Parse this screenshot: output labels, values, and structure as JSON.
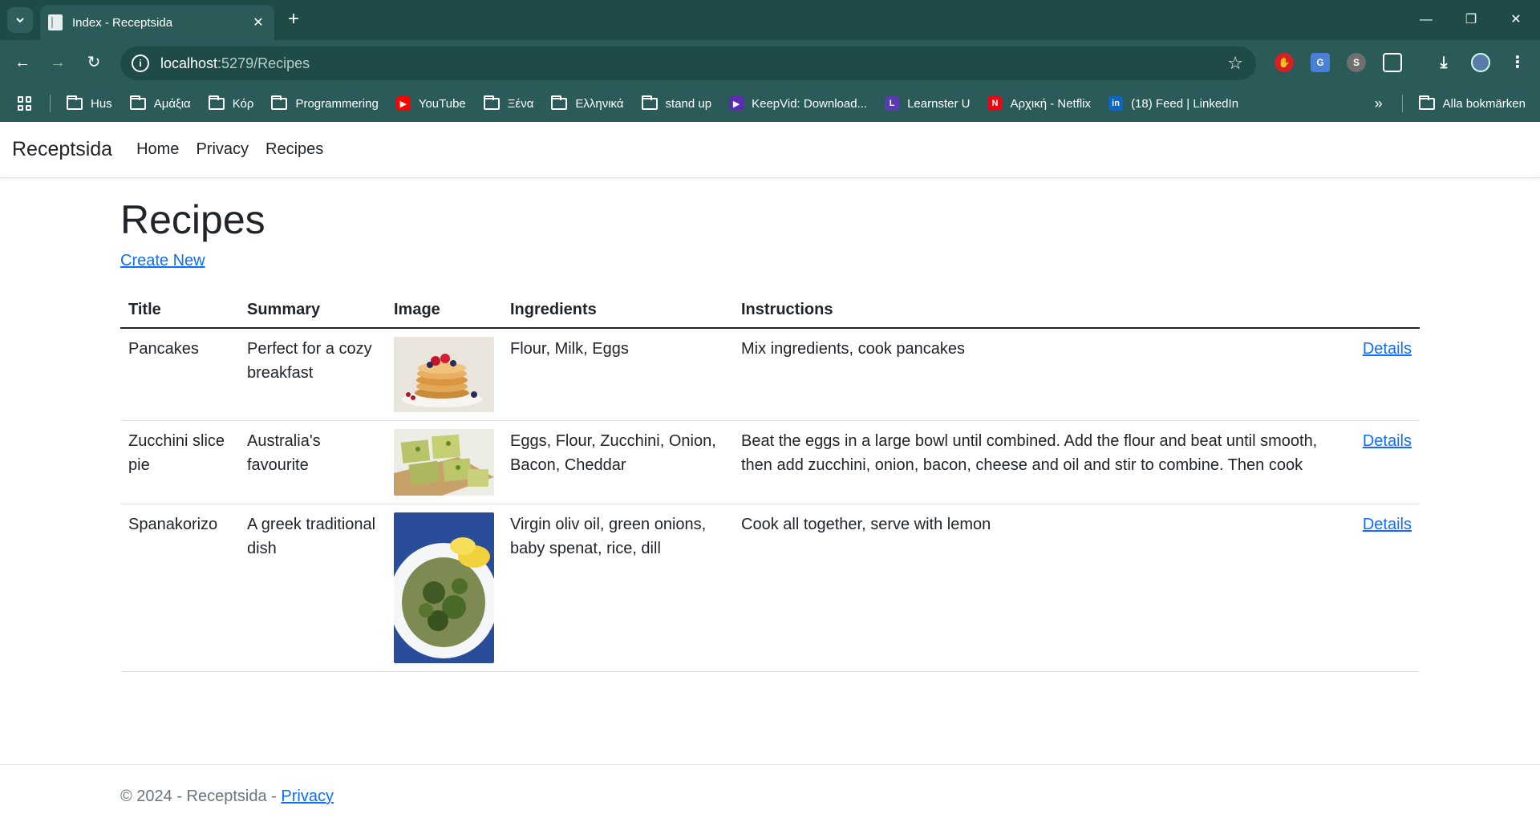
{
  "browser": {
    "tab_title": "Index - Receptsida",
    "url_host": "localhost",
    "url_path": ":5279/Recipes",
    "bookmarks": [
      {
        "label": "Hus",
        "icon": "folder-icon"
      },
      {
        "label": "Αμάξια",
        "icon": "folder-icon"
      },
      {
        "label": "Κόρ",
        "icon": "folder-icon"
      },
      {
        "label": "Programmering",
        "icon": "folder-icon"
      },
      {
        "label": "YouTube",
        "icon": "youtube-icon",
        "color": "#ff0000"
      },
      {
        "label": "Ξένα",
        "icon": "folder-icon"
      },
      {
        "label": "Ελληνικά",
        "icon": "folder-icon"
      },
      {
        "label": "stand up",
        "icon": "folder-icon"
      },
      {
        "label": "KeepVid: Download...",
        "icon": "keepvid-icon",
        "color": "#5b2bb5"
      },
      {
        "label": "Learnster U",
        "icon": "learnster-icon",
        "color": "#5a3ab0"
      },
      {
        "label": "Αρχική - Netflix",
        "icon": "netflix-icon",
        "color": "#e50914"
      },
      {
        "label": "(18) Feed | LinkedIn",
        "icon": "linkedin-icon",
        "color": "#0a66c2"
      }
    ],
    "all_bookmarks": "Alla bokmärken"
  },
  "site": {
    "brand": "Receptsida",
    "nav": [
      "Home",
      "Privacy",
      "Recipes"
    ]
  },
  "page": {
    "title": "Recipes",
    "create_new": "Create New",
    "columns": [
      "Title",
      "Summary",
      "Image",
      "Ingredients",
      "Instructions"
    ],
    "details_label": "Details",
    "rows": [
      {
        "title": "Pancakes",
        "summary": "Perfect for a cozy breakfast",
        "image": "pancakes-image",
        "ingredients": "Flour, Milk, Eggs",
        "instructions": "Mix ingredients, cook pancakes"
      },
      {
        "title": "Zucchini slice pie",
        "summary": "Australia's favourite",
        "image": "zucchini-slice-image",
        "ingredients": "Eggs, Flour, Zucchini, Onion, Bacon, Cheddar",
        "instructions": "Beat the eggs in a large bowl until combined. Add the flour and beat until smooth, then add zucchini, onion, bacon, cheese and oil and stir to combine. Then cook"
      },
      {
        "title": "Spanakorizo",
        "summary": "A greek traditional dish",
        "image": "spanakorizo-image",
        "ingredients": "Virgin oliv oil, green onions, baby spenat, rice, dill",
        "instructions": "Cook all together, serve with lemon"
      }
    ]
  },
  "footer": {
    "text": "© 2024 - Receptsida - ",
    "privacy": "Privacy"
  }
}
